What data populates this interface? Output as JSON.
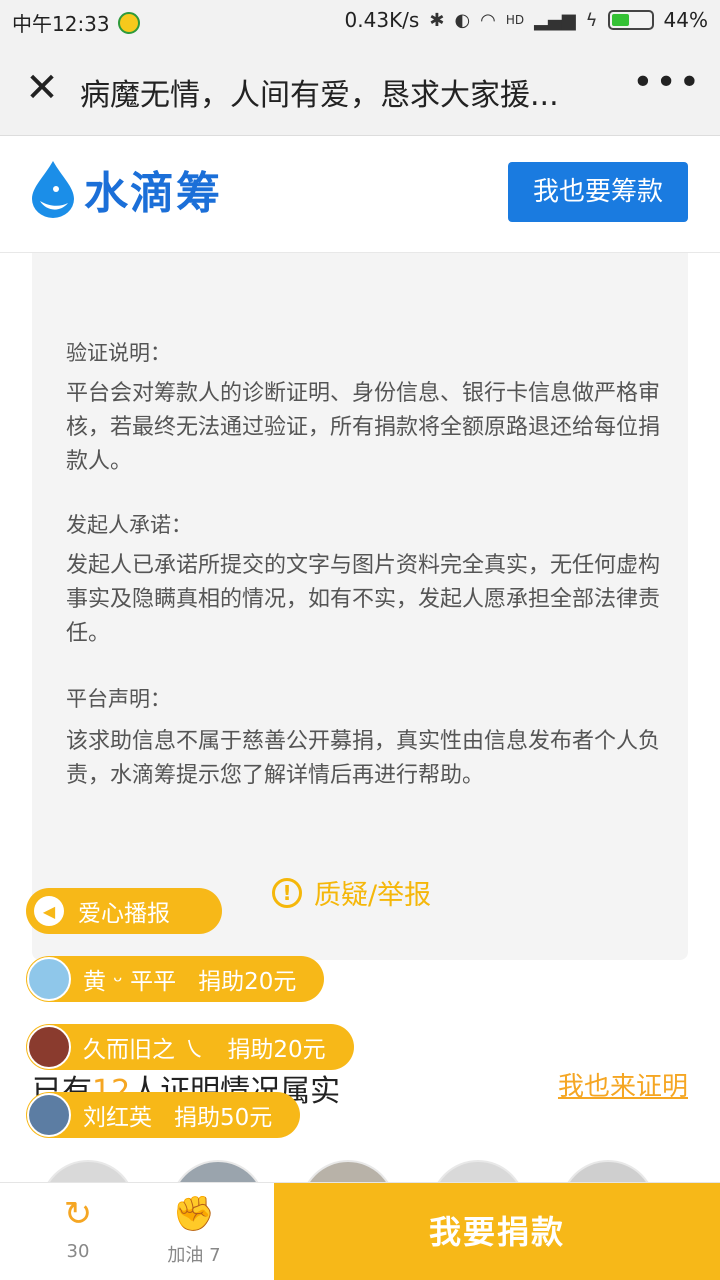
{
  "status_bar": {
    "time": "中午12:33",
    "network_speed": "0.43K/s",
    "hd_label": "HD",
    "battery": "44%",
    "battery_level": 0.44
  },
  "title_bar": {
    "title": "病魔无情，人间有爱，恳求大家援...",
    "more_label": "•••"
  },
  "header": {
    "logo_text": "水滴筹",
    "raise_button": "我也要筹款"
  },
  "content": {
    "sections": [
      {
        "title": "验证说明：",
        "body": "平台会对筹款人的诊断证明、身份信息、银行卡信息做严格审核，若最终无法通过验证，所有捐款将全额原路退还给每位捐款人。"
      },
      {
        "title": "发起人承诺：",
        "body": "发起人已承诺所提交的文字与图片资料完全真实，无任何虚构事实及隐瞒真相的情况，如有不实，发起人愿承担全部法律责任。"
      },
      {
        "title": "平台声明：",
        "body": "该求助信息不属于慈善公开募捐，真实性由信息发布者个人负责，水滴筹提示您了解详情后再进行帮助。"
      }
    ],
    "report_label": "质疑/举报"
  },
  "broadcast": {
    "label": "爱心播报",
    "donations": [
      {
        "name": "黄 ᵕ 平平",
        "amount": "捐助20元"
      },
      {
        "name": "久而旧之 ㇏",
        "amount": "捐助20元"
      },
      {
        "name": "刘红英",
        "amount": "捐助50元"
      }
    ]
  },
  "proof": {
    "prefix": "已有",
    "count": "12",
    "suffix": "人证明情况属实",
    "link": "我也来证明"
  },
  "bottom_bar": {
    "share_count": "30",
    "cheer_label": "加油 7",
    "donate_button": "我要捐款"
  },
  "colors": {
    "brand_blue": "#1a7be0",
    "accent_yellow": "#f7b818",
    "link_orange": "#f5a623"
  }
}
